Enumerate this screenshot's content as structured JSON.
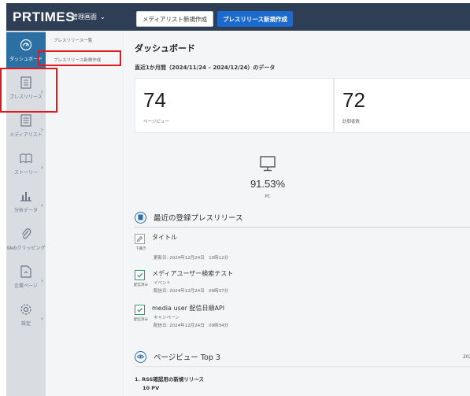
{
  "topbar": {
    "logo": "PRTIMES",
    "company": "管理画面",
    "media_button": "メディアリスト新規作成",
    "press_button": "プレスリリース新規作成"
  },
  "sidenav": [
    {
      "label": "ダッシュボード",
      "icon": "gauge-icon"
    },
    {
      "label": "プレスリリース",
      "icon": "document-icon"
    },
    {
      "label": "メディアリスト",
      "icon": "list-icon"
    },
    {
      "label": "ストーリー",
      "icon": "book-icon"
    },
    {
      "label": "分析データ",
      "icon": "chart-icon"
    },
    {
      "label": "Webクリッピング",
      "icon": "clip-icon"
    },
    {
      "label": "企業ページ",
      "icon": "page-icon"
    },
    {
      "label": "設定",
      "icon": "gear-icon"
    }
  ],
  "subnav": [
    "プレスリリース一覧",
    "プレスリリース新規作成"
  ],
  "main": {
    "title": "ダッシュボード",
    "period": "直近1か月間（2024/11/24 – 2024/12/24）のデータ",
    "cards": [
      {
        "value": "74",
        "caption": "ページビュー"
      },
      {
        "value": "72",
        "caption": "訪問者数"
      }
    ],
    "device": {
      "percent": "91.53%",
      "label": "PC",
      "icon": "monitor-icon"
    },
    "recent_section": {
      "title": "最近の登録プレスリリース",
      "icon": "document-icon"
    },
    "releases": [
      {
        "status": "下書き",
        "title": "タイトル",
        "category": "",
        "date": "更新日: 2024年12月24日　10時12分",
        "icon": "edit-icon"
      },
      {
        "status": "配信済み",
        "title": "メディアユーザー検索テスト",
        "category": "イベント",
        "date": "配信日: 2024年12月24日　09時37分",
        "icon": "check-icon"
      },
      {
        "status": "配信済み",
        "title": "media user 配信日順API",
        "category": "キャンペーン",
        "date": "配信日: 2024年12月24日　09時34分",
        "icon": "check-icon"
      }
    ],
    "pv_section": {
      "title": "ページビュー Top 3",
      "icon": "eye-icon",
      "year": "202"
    },
    "ranking": [
      {
        "name": "1.  RSS確認用の新規リリース",
        "views": "10 PV"
      }
    ]
  },
  "colors": {
    "topbar": "#2e3e55",
    "accent_blue": "#1b6ad0",
    "active_nav": "#2b6fa3",
    "highlight_red": "#e0191c",
    "done_green": "#2f9d63"
  }
}
